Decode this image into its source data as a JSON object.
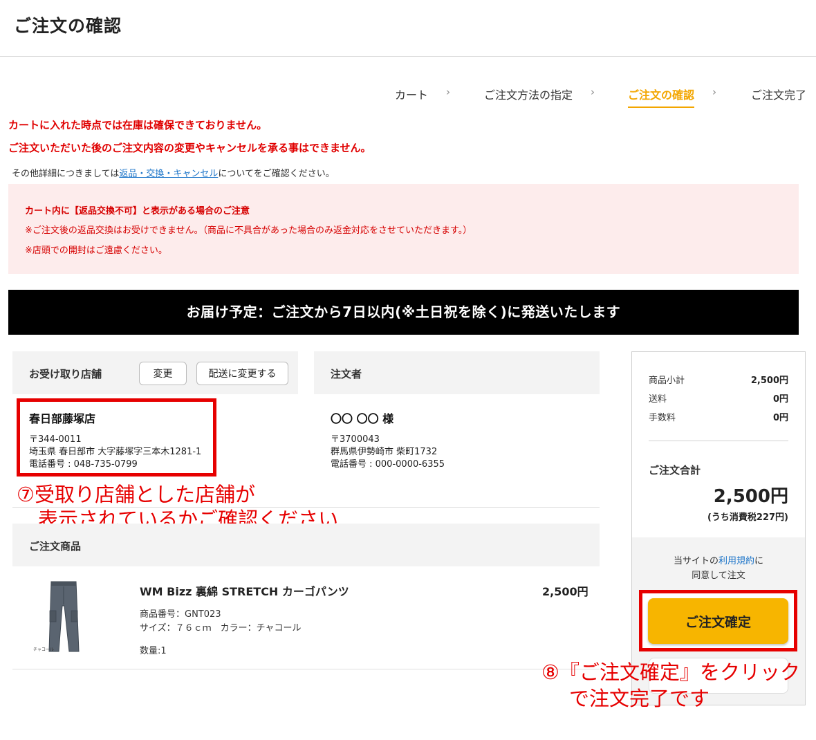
{
  "page": {
    "title": "ご注文の確認"
  },
  "steps": [
    "カート",
    "ご注文方法の指定",
    "ご注文の確認",
    "ご注文完了"
  ],
  "step_separator": "›",
  "warnings": [
    "カートに入れた時点では在庫は確保できておりません。",
    "ご注文いただいた後のご注文内容の変更やキャンセルを承る事はできません。"
  ],
  "info": {
    "prefix": "その他詳細につきましては",
    "link": "返品・交換・キャンセル",
    "suffix": "についてをご確認ください。"
  },
  "notice": {
    "heading": "カート内に【返品交換不可】と表示がある場合のご注意",
    "lines": [
      "※ご注文後の返品交換はお受けできません。（商品に不具合があった場合のみ返金対応をさせていただきます。）",
      "※店頭での開封はご遠慮ください。"
    ]
  },
  "delivery_banner": "お届け予定：ご注文から7日以内(※土日祝を除く)に発送いたします",
  "store": {
    "heading": "お受け取り店舗",
    "change_label": "変更",
    "switch_label": "配送に変更する",
    "name": "春日部藤塚店",
    "postal": "〒344-0011",
    "address": "埼玉県 春日部市 大字藤塚字三本木1281-1",
    "phone": "電話番号 : 048-735-0799"
  },
  "orderer": {
    "heading": "注文者",
    "name": "〇〇 〇〇 様",
    "postal": "〒3700043",
    "address": "群馬県伊勢崎市 柴町1732",
    "phone": "電話番号 : 000-0000-6355"
  },
  "annotations": {
    "store_note": [
      "⑦受取り店舗とした店舗が",
      "表示されているかご確認ください"
    ],
    "confirm_note": [
      "⑧『ご注文確定』をクリック",
      "で注文完了です"
    ]
  },
  "items": {
    "heading": "ご注文商品",
    "list": [
      {
        "name": "WM Bizz 裏綿 STRETCH カーゴパンツ",
        "price": "2,500円",
        "sku": "商品番号：GNT023",
        "options": "サイズ：７６ｃｍ　カラー：チャコール",
        "qty": "数量:1",
        "image_caption": "チャコール"
      }
    ]
  },
  "summary": {
    "subtotal_label": "商品小計",
    "subtotal": "2,500円",
    "shipping_label": "送料",
    "shipping": "0円",
    "fee_label": "手数料",
    "fee": "0円",
    "total_label": "ご注文合計",
    "total": "2,500円",
    "tax_note": "(うち消費税227円)",
    "agree_prefix": "当サイトの",
    "agree_link": "利用規約",
    "agree_suffix": "に",
    "agree_line2": "同意して注文",
    "confirm_label": "ご注文確定"
  },
  "colors": {
    "accent": "#f3a600",
    "confirm_button": "#f7b500",
    "warning": "#e00000",
    "notice_bg": "#fdecec",
    "link": "#1a73c8"
  }
}
